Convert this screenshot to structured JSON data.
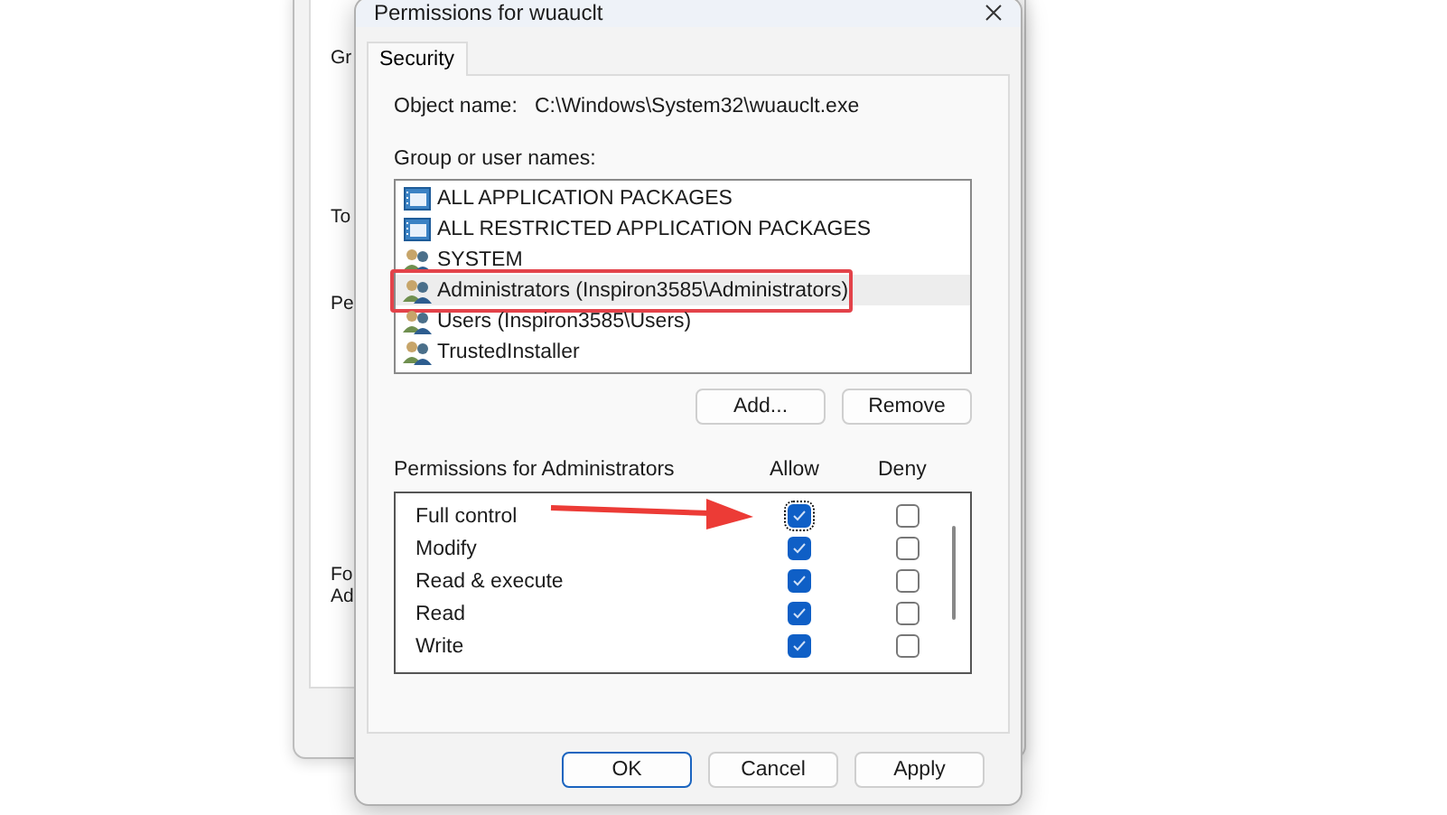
{
  "background_window": {
    "labels": [
      "Gr",
      "To",
      "Pe",
      "Fo",
      "Ad"
    ]
  },
  "dialog": {
    "title": "Permissions for wuauclt"
  },
  "tabs": [
    {
      "label": "Security",
      "selected": true
    }
  ],
  "object_name": {
    "label": "Object name:",
    "value": "C:\\Windows\\System32\\wuauclt.exe"
  },
  "group_label": "Group or user names:",
  "groups": [
    {
      "name": "ALL APPLICATION PACKAGES",
      "kind": "package",
      "selected": false
    },
    {
      "name": "ALL RESTRICTED APPLICATION PACKAGES",
      "kind": "package",
      "selected": false
    },
    {
      "name": "SYSTEM",
      "kind": "users",
      "selected": false
    },
    {
      "name": "Administrators (Inspiron3585\\Administrators)",
      "kind": "users",
      "selected": true
    },
    {
      "name": "Users (Inspiron3585\\Users)",
      "kind": "users",
      "selected": false
    },
    {
      "name": "TrustedInstaller",
      "kind": "users",
      "selected": false
    }
  ],
  "group_buttons": [
    "Add...",
    "Remove"
  ],
  "permissions": {
    "label": "Permissions for Administrators",
    "allow_header": "Allow",
    "deny_header": "Deny",
    "rows": [
      {
        "name": "Full control",
        "allow": true,
        "deny": false
      },
      {
        "name": "Modify",
        "allow": true,
        "deny": false
      },
      {
        "name": "Read & execute",
        "allow": true,
        "deny": false
      },
      {
        "name": "Read",
        "allow": true,
        "deny": false
      },
      {
        "name": "Write",
        "allow": true,
        "deny": false
      }
    ]
  },
  "buttons": [
    "OK",
    "Cancel",
    "Apply"
  ]
}
